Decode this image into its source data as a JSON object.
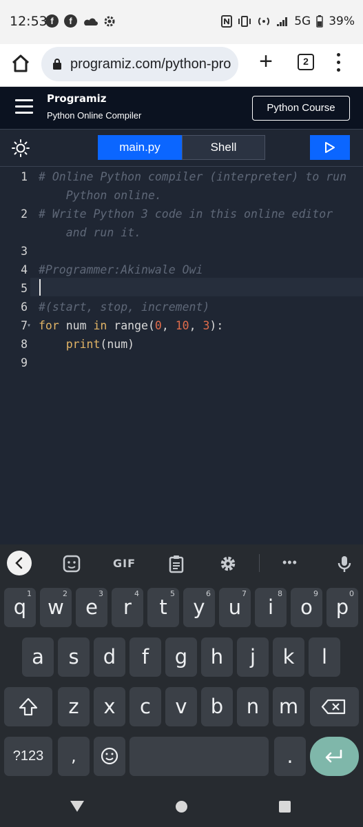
{
  "status_bar": {
    "time": "12:53",
    "network": "5G",
    "battery": "39%"
  },
  "browser": {
    "url": "programiz.com/python-pro",
    "tab_count": "2"
  },
  "header": {
    "brand": "Programiz",
    "subtitle": "Python Online Compiler",
    "course_button": "Python Course"
  },
  "toolbar": {
    "tab_main": "main.py",
    "tab_shell": "Shell"
  },
  "editor": {
    "line_numbers": [
      "1",
      "2",
      "3",
      "4",
      "5",
      "6",
      "7",
      "8",
      "9"
    ],
    "lines": {
      "l1a": "# Online Python compiler (interpreter) to run",
      "l1b": "    Python online.",
      "l2a": "# Write Python 3 code in this online editor",
      "l2b": "    and run it.",
      "l4": "#Programmer:Akinwale Owi",
      "l6": "#(start, stop, increment)",
      "l7_for": "for",
      "l7_var": " num ",
      "l7_in": "in",
      "l7_range": " range(",
      "l7_n1": "0",
      "l7_c1": ", ",
      "l7_n2": "10",
      "l7_c2": ", ",
      "l7_n3": "3",
      "l7_end": "):",
      "l8_indent": "    ",
      "l8_print": "print",
      "l8_args": "(num)"
    }
  },
  "keyboard": {
    "gif_label": "GIF",
    "row1": [
      {
        "k": "q",
        "h": "1"
      },
      {
        "k": "w",
        "h": "2"
      },
      {
        "k": "e",
        "h": "3"
      },
      {
        "k": "r",
        "h": "4"
      },
      {
        "k": "t",
        "h": "5"
      },
      {
        "k": "y",
        "h": "6"
      },
      {
        "k": "u",
        "h": "7"
      },
      {
        "k": "i",
        "h": "8"
      },
      {
        "k": "o",
        "h": "9"
      },
      {
        "k": "p",
        "h": "0"
      }
    ],
    "row2": [
      "a",
      "s",
      "d",
      "f",
      "g",
      "h",
      "j",
      "k",
      "l"
    ],
    "row3": [
      "z",
      "x",
      "c",
      "v",
      "b",
      "n",
      "m"
    ],
    "symbols_key": "?123",
    "comma_key": ",",
    "period_key": "."
  },
  "colors": {
    "accent": "#0b66ff",
    "editor_bg": "#1f2633",
    "header_bg": "#0b1220",
    "keyword": "#e2b466",
    "number": "#e06c4b",
    "comment": "#5f6878"
  }
}
